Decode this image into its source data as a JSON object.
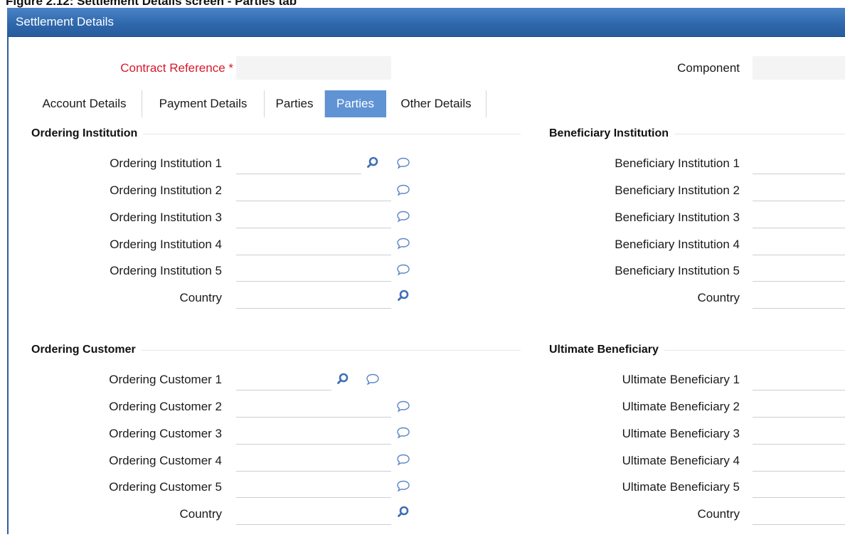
{
  "caption": "Figure 2.12: Settlement Details screen - Parties tab",
  "window": {
    "title": "Settlement Details"
  },
  "header": {
    "contract_reference_label": "Contract Reference *",
    "contract_reference_value": "",
    "component_label": "Component",
    "component_value": ""
  },
  "tabs": [
    {
      "label": "Account Details",
      "active": false
    },
    {
      "label": "Payment Details",
      "active": false
    },
    {
      "label": "Parties",
      "active": false
    },
    {
      "label": "Parties",
      "active": true
    },
    {
      "label": "Other Details",
      "active": false
    }
  ],
  "ordering_institution": {
    "title": "Ordering Institution",
    "fields": [
      {
        "label": "Ordering Institution 1",
        "value": ""
      },
      {
        "label": "Ordering Institution 2",
        "value": ""
      },
      {
        "label": "Ordering Institution 3",
        "value": ""
      },
      {
        "label": "Ordering Institution 4",
        "value": ""
      },
      {
        "label": "Ordering Institution 5",
        "value": ""
      },
      {
        "label": "Country",
        "value": ""
      }
    ]
  },
  "beneficiary_institution": {
    "title": "Beneficiary Institution",
    "fields": [
      {
        "label": "Beneficiary Institution 1",
        "value": ""
      },
      {
        "label": "Beneficiary Institution 2",
        "value": ""
      },
      {
        "label": "Beneficiary Institution 3",
        "value": ""
      },
      {
        "label": "Beneficiary Institution 4",
        "value": ""
      },
      {
        "label": "Beneficiary Institution 5",
        "value": ""
      },
      {
        "label": "Country",
        "value": ""
      }
    ]
  },
  "ordering_customer": {
    "title": "Ordering Customer",
    "fields": [
      {
        "label": "Ordering Customer 1",
        "value": ""
      },
      {
        "label": "Ordering Customer 2",
        "value": ""
      },
      {
        "label": "Ordering Customer 3",
        "value": ""
      },
      {
        "label": "Ordering Customer 4",
        "value": ""
      },
      {
        "label": "Ordering Customer 5",
        "value": ""
      },
      {
        "label": "Country",
        "value": ""
      }
    ]
  },
  "ultimate_beneficiary": {
    "title": "Ultimate Beneficiary",
    "fields": [
      {
        "label": "Ultimate Beneficiary 1",
        "value": ""
      },
      {
        "label": "Ultimate Beneficiary 2",
        "value": ""
      },
      {
        "label": "Ultimate Beneficiary 3",
        "value": ""
      },
      {
        "label": "Ultimate Beneficiary 4",
        "value": ""
      },
      {
        "label": "Ultimate Beneficiary 5",
        "value": ""
      },
      {
        "label": "Country",
        "value": ""
      }
    ]
  },
  "icons": {
    "lookup": "search-icon",
    "narrative": "speech-bubble-icon"
  },
  "colors": {
    "titlebar": "#2f68ad",
    "active_tab": "#5f93d4",
    "required_label": "#d7192a",
    "icon": "#3f6fb5"
  }
}
